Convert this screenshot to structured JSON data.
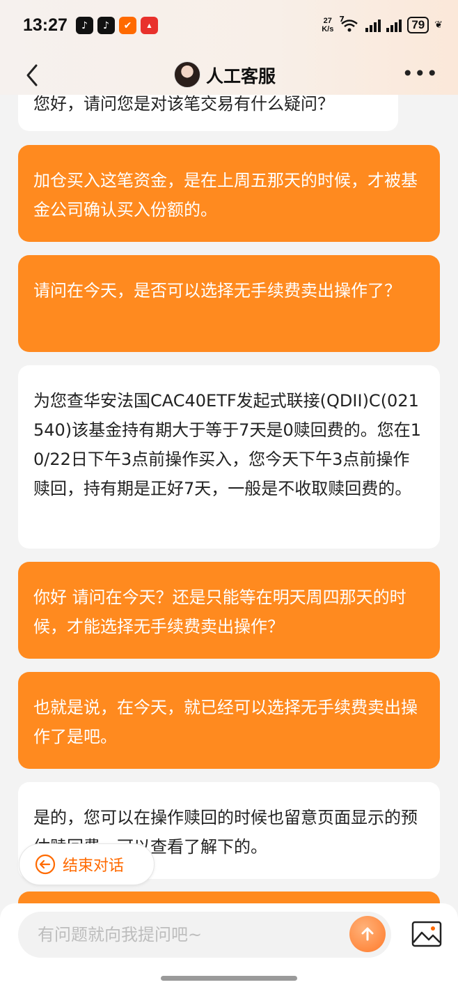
{
  "status_bar": {
    "time": "13:27",
    "net_speed_value": "27",
    "net_speed_unit": "K/s",
    "wifi_label": "7",
    "battery": "79"
  },
  "header": {
    "title": "人工客服"
  },
  "messages": [
    {
      "role": "agent",
      "text": "您好，请问您是对该笔交易有什么疑问？"
    },
    {
      "role": "user",
      "text": "加仓买入这笔资金，是在上周五那天的时候，才被基金公司确认买入份额的。"
    },
    {
      "role": "user",
      "text": "请问在今天，是否可以选择无手续费卖出操作了？"
    },
    {
      "role": "agent",
      "text": "为您查华安法国CAC40ETF发起式联接(QDII)C(021540)该基金持有期大于等于7天是0赎回费的。您在10/22日下午3点前操作买入，您今天下午3点前操作赎回，持有期是正好7天，一般是不收取赎回费的。"
    },
    {
      "role": "user",
      "text": "你好 请问在今天？还是只能等在明天周四那天的时候，才能选择无手续费卖出操作？"
    },
    {
      "role": "user",
      "text": "也就是说，在今天，就已经可以选择无手续费卖出操作了是吧。"
    },
    {
      "role": "agent",
      "text": "是的，您可以在操作赎回的时候也留意页面显示的预估赎回费，可以查看了解下的。"
    }
  ],
  "end_chat": {
    "label": "结束对话"
  },
  "input": {
    "placeholder": "有问题就向我提问吧~"
  },
  "colors": {
    "accent": "#ff8a1f",
    "agent_bubble": "#ffffff",
    "background": "#f3f3f3"
  }
}
